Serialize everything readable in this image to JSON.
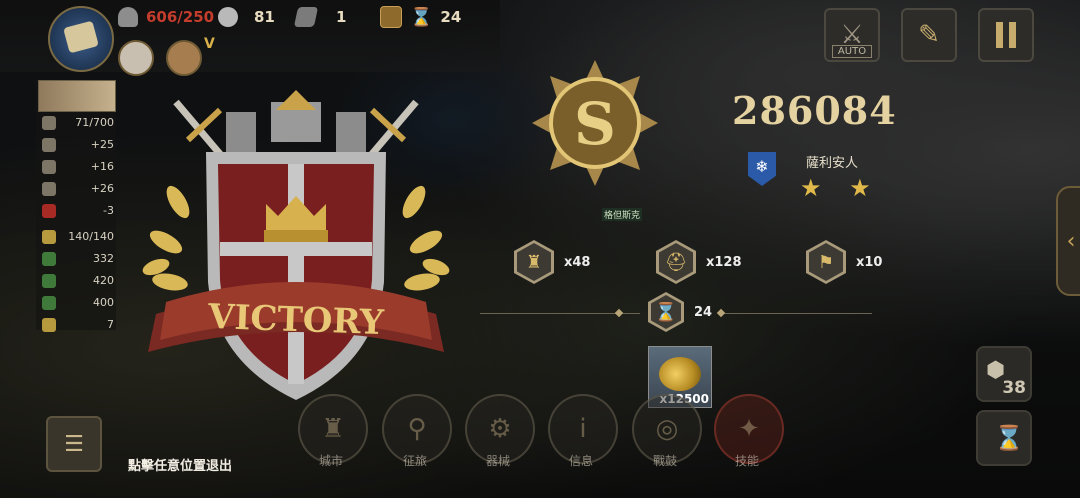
{
  "hud": {
    "troops": "606/250",
    "silver": "81",
    "iron": "1",
    "turns": "24",
    "rank_badge": "V"
  },
  "left_panel": {
    "rows": [
      "71/700",
      "+25",
      "+16",
      "+26",
      "-3",
      "140/140",
      "332",
      "420",
      "400",
      "7"
    ]
  },
  "victory": {
    "ribbon_text": "VICTORY"
  },
  "result": {
    "score": "286084",
    "general_name": "薩利安人",
    "stars": "★ ★",
    "rewards": [
      {
        "icon": "city-icon",
        "qty": "x48"
      },
      {
        "icon": "helmet-icon",
        "qty": "x128"
      },
      {
        "icon": "flag-icon",
        "qty": "x10"
      }
    ],
    "hourglass_count": "24",
    "coins_qty": "x12500"
  },
  "top_right": {
    "auto_label": "AUTO"
  },
  "bottom_nav": [
    {
      "label": "城市"
    },
    {
      "label": "征旅"
    },
    {
      "label": "器械"
    },
    {
      "label": "信息"
    },
    {
      "label": "戰鼓"
    },
    {
      "label": "技能"
    }
  ],
  "exit_hint": "點擊任意位置退出",
  "side_buttons": {
    "hex_count": "38"
  },
  "map_labels": [
    "格但斯克"
  ],
  "colors": {
    "gold": "#e4d2a0",
    "red_alert": "#c43c2c",
    "shield_red": "#7a1f1f"
  }
}
